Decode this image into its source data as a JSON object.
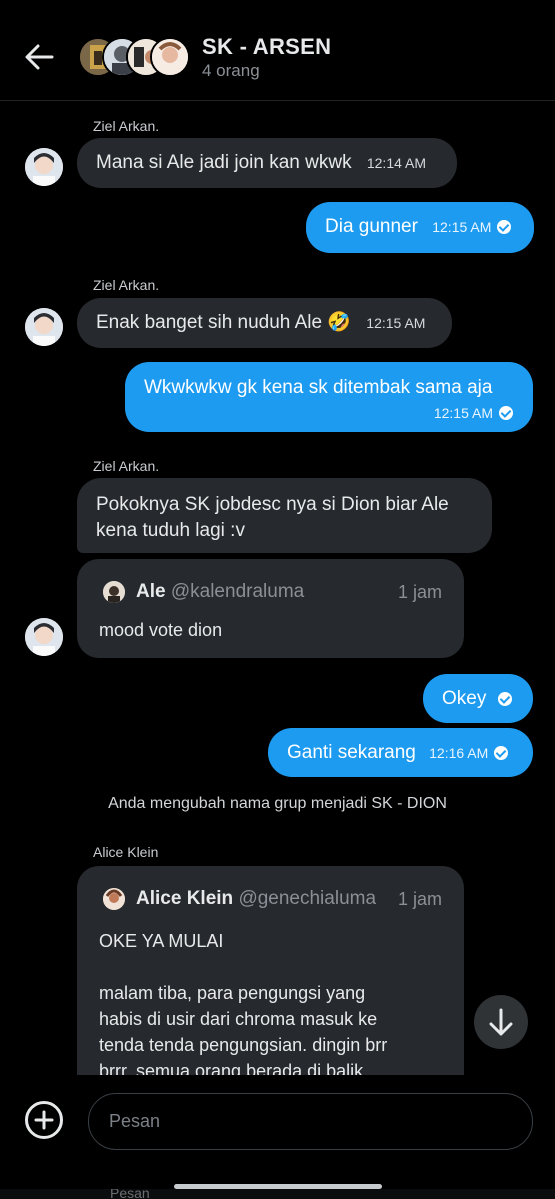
{
  "header": {
    "title": "SK - ARSEN",
    "subtitle": "4 orang"
  },
  "messages": [
    {
      "type": "incoming",
      "sender": "Ziel Arkan.",
      "text": "Mana si Ale jadi join kan wkwk",
      "time": "12:14 AM"
    },
    {
      "type": "outgoing",
      "text": "Dia gunner",
      "time": "12:15 AM"
    },
    {
      "type": "incoming",
      "sender": "Ziel Arkan.",
      "text": "Enak banget sih nuduh Ale 🤣",
      "time": "12:15 AM"
    },
    {
      "type": "outgoing",
      "text": "Wkwkwkw gk kena sk ditembak sama aja",
      "time": "12:15 AM"
    },
    {
      "type": "incoming",
      "sender": "Ziel Arkan.",
      "text_line1": "Pokoknya SK jobdesc nya si Dion biar Ale",
      "text_line2": "kena tuduh lagi :v",
      "quote": {
        "name": "Ale",
        "handle": "@kalendraluma",
        "ago": "1 jam",
        "text": "mood vote dion"
      }
    },
    {
      "type": "outgoing",
      "text": "Okey"
    },
    {
      "type": "outgoing",
      "text": "Ganti sekarang",
      "time": "12:16 AM"
    },
    {
      "type": "incoming",
      "sender": "Alice Klein",
      "quote": {
        "name": "Alice Klein",
        "handle": "@genechialuma",
        "ago": "1 jam",
        "line1": "OKE YA MULAI",
        "line2": "malam tiba, para pengungsi yang",
        "line3": "habis di usir dari chroma masuk ke",
        "line4": "tenda tenda pengungsian. dingin brr",
        "line5": "brrr. semua orang berada di balik"
      }
    }
  ],
  "system_message": "Anda mengubah nama grup menjadi SK - DION",
  "composer": {
    "placeholder": "Pesan"
  },
  "ghost_text": "Pesan",
  "colors": {
    "accent": "#1d9bf0",
    "bubble_in": "#26292d",
    "background": "#000000"
  }
}
